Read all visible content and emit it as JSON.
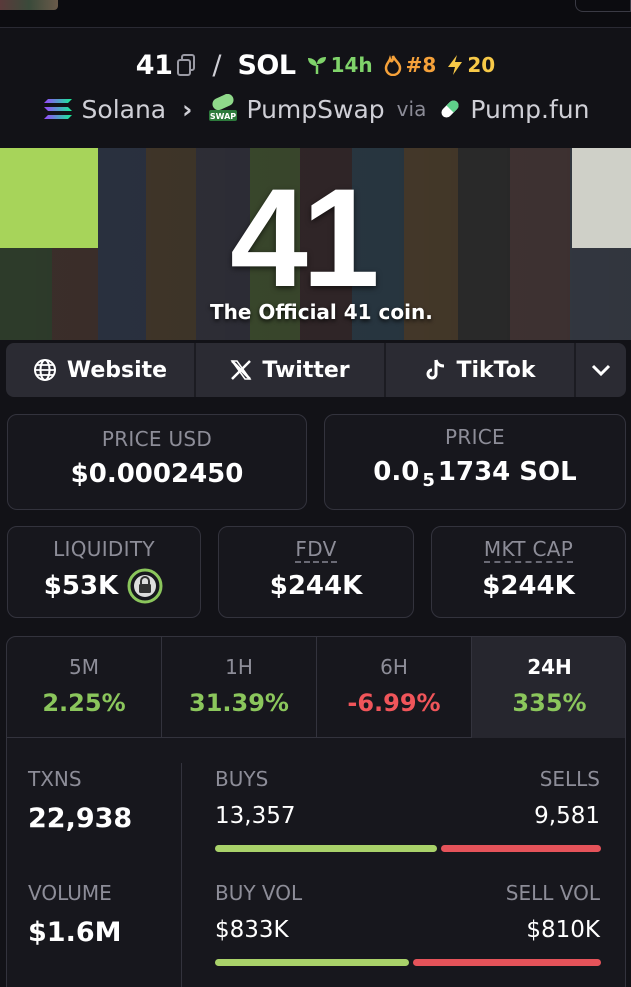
{
  "pair": {
    "base": "41",
    "quote": "SOL",
    "age": "14h",
    "rank": "#8",
    "boosts": "20"
  },
  "chain": {
    "name": "Solana",
    "dex": "PumpSwap",
    "via_label": "via",
    "launchpad": "Pump.fun",
    "swap_badge": "SWAP"
  },
  "banner": {
    "headline": "41",
    "tagline": "The Official 41 coin."
  },
  "links": {
    "website": "Website",
    "twitter": "Twitter",
    "tiktok": "TikTok"
  },
  "prices": {
    "usd_label": "PRICE USD",
    "usd_value": "$0.0002450",
    "native_label": "PRICE",
    "native_prefix": "0.0",
    "native_subscript": "5",
    "native_suffix": "1734 SOL"
  },
  "metrics": {
    "liquidity_label": "LIQUIDITY",
    "liquidity_value": "$53K",
    "fdv_label": "FDV",
    "fdv_value": "$244K",
    "mcap_label": "MKT CAP",
    "mcap_value": "$244K"
  },
  "timeframes": [
    {
      "label": "5M",
      "change": "2.25%"
    },
    {
      "label": "1H",
      "change": "31.39%"
    },
    {
      "label": "6H",
      "change": "-6.99%"
    },
    {
      "label": "24H",
      "change": "335%"
    }
  ],
  "stats": {
    "txns_label": "TXNS",
    "txns_value": "22,938",
    "buys_label": "BUYS",
    "buys_value": "13,357",
    "sells_label": "SELLS",
    "sells_value": "9,581",
    "volume_label": "VOLUME",
    "volume_value": "$1.6M",
    "buy_vol_label": "BUY VOL",
    "buy_vol_value": "$833K",
    "sell_vol_label": "SELL VOL",
    "sell_vol_value": "$810K",
    "buy_share_txns": 0.582,
    "buy_share_volume": 0.507
  },
  "colors": {
    "positive": "#8bc65c",
    "negative": "#f0555a",
    "buy_bar": "#a9d26a",
    "sell_bar": "#e5535a",
    "age": "#7fd36a",
    "rank": "#f5a13a",
    "boost": "#f7c948"
  }
}
